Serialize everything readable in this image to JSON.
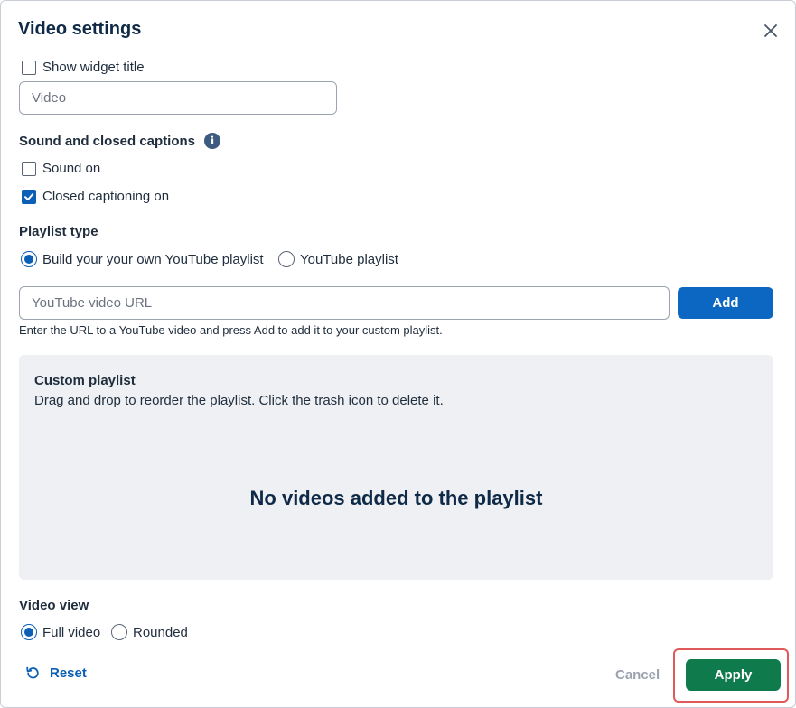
{
  "dialog": {
    "title": "Video settings"
  },
  "widget_title": {
    "checkbox_label": "Show widget title",
    "checked": false,
    "input_value": "Video"
  },
  "sound": {
    "section_label": "Sound and closed captions",
    "sound_on_label": "Sound on",
    "sound_on_checked": false,
    "captions_label": "Closed captioning on",
    "captions_checked": true
  },
  "playlist_type": {
    "section_label": "Playlist type",
    "options": [
      {
        "label": "Build your your own YouTube playlist",
        "selected": true
      },
      {
        "label": "YouTube playlist",
        "selected": false
      }
    ]
  },
  "url_input": {
    "placeholder": "YouTube video URL",
    "add_label": "Add",
    "hint": "Enter the URL to a YouTube video and press Add to add it to your custom playlist."
  },
  "custom_playlist": {
    "title": "Custom playlist",
    "subtitle": "Drag and drop to reorder the playlist. Click the trash icon to delete it.",
    "empty_message": "No videos added to the playlist"
  },
  "video_view": {
    "section_label": "Video view",
    "options": [
      {
        "label": "Full video",
        "selected": true
      },
      {
        "label": "Rounded",
        "selected": false
      }
    ]
  },
  "footer": {
    "reset_label": "Reset",
    "cancel_label": "Cancel",
    "apply_label": "Apply"
  },
  "colors": {
    "primary_blue": "#0b67c2",
    "apply_green": "#0f7a4c",
    "highlight_red": "#e05a5a",
    "panel_bg": "#eef0f4",
    "heading_navy": "#0f2a46"
  },
  "icons": {
    "close": "close-icon",
    "info": "info-icon",
    "reset": "reset-icon",
    "check": "check-icon"
  }
}
